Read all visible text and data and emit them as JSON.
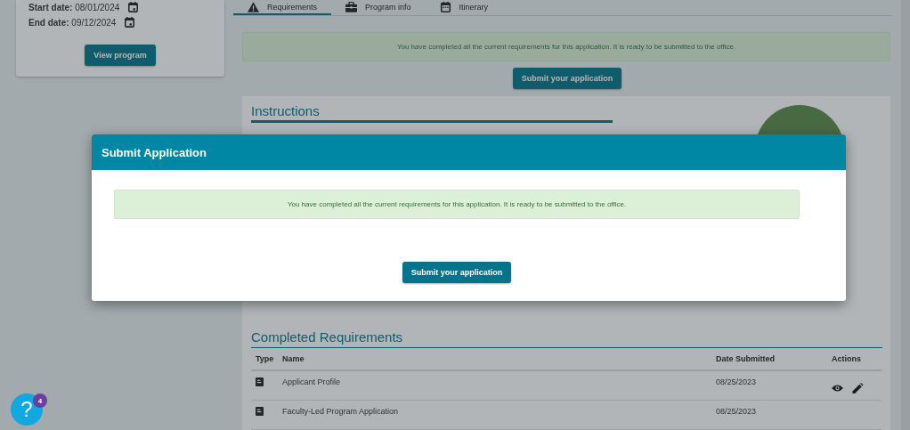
{
  "program_card": {
    "start_date_label": "Start date:",
    "start_date": "08/01/2024",
    "end_date_label": "End date:",
    "end_date": "09/12/2024",
    "button": "View program"
  },
  "tabs": [
    {
      "label": "Requirements",
      "selected": true
    },
    {
      "label": "Program info",
      "selected": false
    },
    {
      "label": "Itinerary",
      "selected": false
    }
  ],
  "alert": "You have completed all the current requirements for this application. It is ready to be submitted to the office.",
  "submit_button": "Submit your application",
  "instructions": {
    "title": "Instructions"
  },
  "completed": {
    "title": "Completed Requirements",
    "columns": [
      "Type",
      "Name",
      "Date Submitted",
      "Actions"
    ],
    "rows": [
      {
        "name": "Applicant Profile",
        "date": "08/25/2023",
        "actions": true
      },
      {
        "name": "Faculty-Led Program Application",
        "date": "08/25/2023",
        "actions": false
      }
    ]
  },
  "help": {
    "label": "?",
    "badge": "4"
  },
  "modal": {
    "title": "Submit Application",
    "alert": "You have completed all the current requirements for this application. It is ready to be submitted to the office.",
    "button": "Submit your application"
  }
}
